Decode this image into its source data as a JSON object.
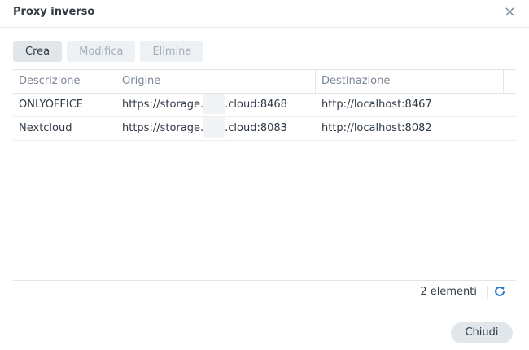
{
  "window": {
    "title": "Proxy inverso",
    "close_glyph": "×"
  },
  "toolbar": {
    "create": "Crea",
    "edit": "Modifica",
    "delete": "Elimina"
  },
  "table": {
    "headers": [
      "Descrizione",
      "Origine",
      "Destinazione"
    ],
    "rows": [
      {
        "description": "ONLYOFFICE",
        "origin_prefix": "https://storage.",
        "origin_suffix": ".cloud:8468",
        "destination": "http://localhost:8467"
      },
      {
        "description": "Nextcloud",
        "origin_prefix": "https://storage.",
        "origin_suffix": ".cloud:8083",
        "destination": "http://localhost:8082"
      }
    ]
  },
  "footer": {
    "count": "2 elementi",
    "refresh_icon": "refresh-icon"
  },
  "actions": {
    "close": "Chiudi"
  },
  "colors": {
    "accent": "#2a7ad2",
    "button_bg": "#e1e6eb",
    "disabled_text": "#a5afb9"
  }
}
